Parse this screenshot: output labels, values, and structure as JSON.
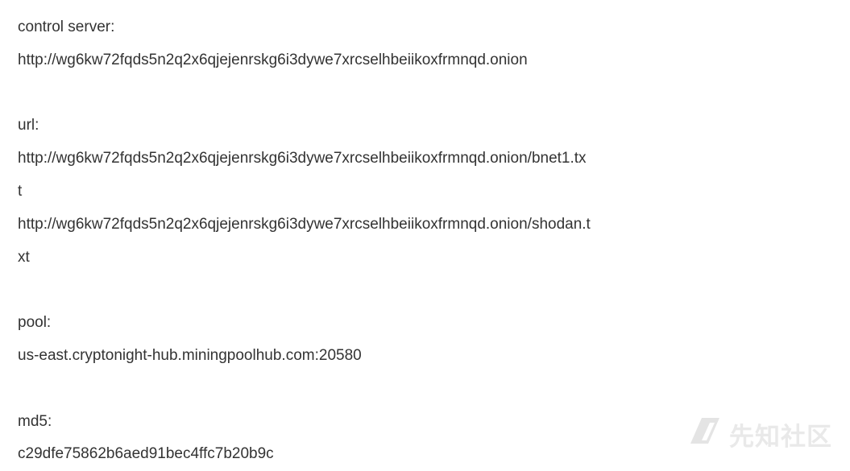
{
  "document": {
    "lines": [
      "control server:",
      "http://wg6kw72fqds5n2q2x6qjejenrskg6i3dywe7xrcselhbeiikoxfrmnqd.onion",
      "",
      "url:",
      "http://wg6kw72fqds5n2q2x6qjejenrskg6i3dywe7xrcselhbeiikoxfrmnqd.onion/bnet1.tx",
      "t",
      "http://wg6kw72fqds5n2q2x6qjejenrskg6i3dywe7xrcselhbeiikoxfrmnqd.onion/shodan.t",
      "xt",
      "",
      "pool:",
      "us-east.cryptonight-hub.miningpoolhub.com:20580",
      "",
      "md5:",
      "c29dfe75862b6aed91bec4ffc7b20b9c"
    ]
  },
  "watermark": {
    "text": "先知社区",
    "icon": "xianzhi-logo-icon",
    "color": "#e9e9e9"
  }
}
